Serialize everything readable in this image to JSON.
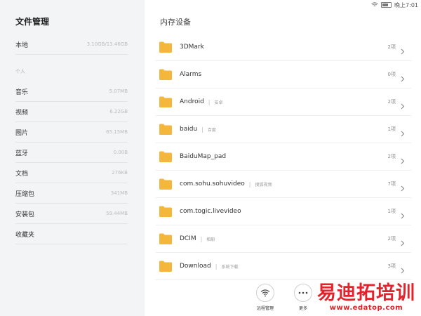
{
  "status": {
    "time": "晚上7:01"
  },
  "sidebar": {
    "title": "文件管理",
    "local": {
      "label": "本地",
      "value": "3.10GB/13.46GB"
    },
    "section_label": "个人",
    "items": [
      {
        "label": "音乐",
        "value": "5.07MB"
      },
      {
        "label": "视频",
        "value": "6.22GB"
      },
      {
        "label": "图片",
        "value": "65.15MB"
      },
      {
        "label": "蓝牙",
        "value": "0.00B"
      },
      {
        "label": "文档",
        "value": "276KB"
      },
      {
        "label": "压缩包",
        "value": "341MB"
      },
      {
        "label": "安装包",
        "value": "59.44MB"
      },
      {
        "label": "收藏夹",
        "value": ""
      }
    ]
  },
  "main": {
    "title": "内存设备",
    "folders": [
      {
        "name": "3DMark",
        "alias": "",
        "count": "2项"
      },
      {
        "name": "Alarms",
        "alias": "",
        "count": "0项"
      },
      {
        "name": "Android",
        "alias": "安卓",
        "count": "2项"
      },
      {
        "name": "baidu",
        "alias": "百度",
        "count": "1项"
      },
      {
        "name": "BaiduMap_pad",
        "alias": "",
        "count": "2项"
      },
      {
        "name": "com.sohu.sohuvideo",
        "alias": "搜狐视频",
        "count": "7项"
      },
      {
        "name": "com.togic.livevideo",
        "alias": "",
        "count": "1项"
      },
      {
        "name": "DCIM",
        "alias": "相册",
        "count": "2项"
      },
      {
        "name": "Download",
        "alias": "系统下载",
        "count": "3项"
      }
    ]
  },
  "toolbar": {
    "remote_label": "远程管理",
    "more_label": "更多"
  },
  "watermark": {
    "text": "易迪拓培训",
    "url": "www.edatop.com"
  },
  "colors": {
    "folder": "#f5b73b",
    "sidebar_bg": "#f2f4f5",
    "watermark": "#e2232b"
  },
  "icons": {
    "folder": "folder-icon",
    "chevron": "chevron-right-icon",
    "wifi": "wifi-icon",
    "battery": "battery-icon",
    "more": "more-icon"
  }
}
